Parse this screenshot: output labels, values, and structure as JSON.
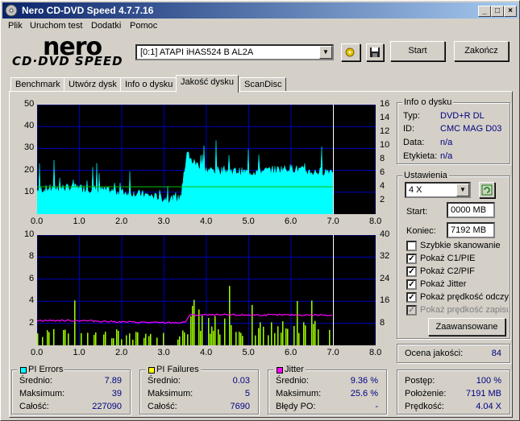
{
  "window": {
    "title": "Nero CD-DVD Speed 4.7.7.16"
  },
  "menu": [
    "Plik",
    "Uruchom test",
    "Dodatki",
    "Pomoc"
  ],
  "logo": {
    "top": "nero",
    "bottom": "CD·DVD SPEED"
  },
  "drive": {
    "selected": "[0:1]   ATAPI iHAS524   B AL2A"
  },
  "buttons": {
    "start": "Start",
    "end": "Zakończ",
    "advanced": "Zaawansowane"
  },
  "tabs": [
    "Benchmark",
    "Utwórz dysk",
    "Info o dysku",
    "Jakość dysku",
    "ScanDisc"
  ],
  "active_tab": "Jakość dysku",
  "disc_info": {
    "title": "Info o dysku",
    "rows": [
      {
        "label": "Typ:",
        "value": "DVD+R DL"
      },
      {
        "label": "ID:",
        "value": "CMC MAG D03"
      },
      {
        "label": "Data:",
        "value": "n/a"
      },
      {
        "label": "Etykieta:",
        "value": "n/a"
      }
    ]
  },
  "settings": {
    "title": "Ustawienia",
    "speed": "4 X",
    "start_label": "Start:",
    "start_value": "0000 MB",
    "end_label": "Koniec:",
    "end_value": "7192 MB",
    "checks": [
      {
        "label": "Szybkie skanowanie",
        "checked": false,
        "disabled": false
      },
      {
        "label": "Pokaż C1/PIE",
        "checked": true,
        "disabled": false
      },
      {
        "label": "Pokaż C2/PIF",
        "checked": true,
        "disabled": false
      },
      {
        "label": "Pokaż Jitter",
        "checked": true,
        "disabled": false
      },
      {
        "label": "Pokaż prędkość odczytu",
        "checked": true,
        "disabled": false
      },
      {
        "label": "Pokaż prędkość zapisu",
        "checked": true,
        "disabled": true
      }
    ]
  },
  "quality": {
    "label": "Ocena jakości:",
    "value": "84"
  },
  "progress": {
    "rows": [
      {
        "label": "Postęp:",
        "value": "100 %"
      },
      {
        "label": "Położenie:",
        "value": "7191 MB"
      },
      {
        "label": "Prędkość:",
        "value": "4.04 X"
      }
    ]
  },
  "pi_errors": {
    "title": "PI Errors",
    "color": "#00c0c0",
    "rows": [
      {
        "label": "Średnio:",
        "value": "7.89"
      },
      {
        "label": "Maksimum:",
        "value": "39"
      },
      {
        "label": "Całość:",
        "value": "227090"
      }
    ]
  },
  "pi_failures": {
    "title": "PI Failures",
    "color": "#e0e000",
    "rows": [
      {
        "label": "Średnio:",
        "value": "0.03"
      },
      {
        "label": "Maksimum:",
        "value": "5"
      },
      {
        "label": "Całość:",
        "value": "7690"
      }
    ]
  },
  "jitter": {
    "title": "Jitter",
    "color": "#e000e0",
    "rows": [
      {
        "label": "Średnio:",
        "value": "9.36 %"
      },
      {
        "label": "Maksimum:",
        "value": "25.6 %"
      },
      {
        "label": "Błędy PO:",
        "value": "-"
      }
    ]
  },
  "chart_data": [
    {
      "type": "area",
      "title": "",
      "xlabel": "",
      "ylabel": "",
      "x_ticks": [
        "0.0",
        "1.0",
        "2.0",
        "3.0",
        "4.0",
        "5.0",
        "6.0",
        "7.0",
        "8.0"
      ],
      "y_left_ticks": [
        "10",
        "20",
        "30",
        "40",
        "50"
      ],
      "y_right_ticks": [
        "2",
        "4",
        "6",
        "8",
        "10",
        "12",
        "14",
        "16"
      ],
      "xlim": [
        0,
        8
      ],
      "ylim": [
        0,
        50
      ],
      "y2lim": [
        0,
        16
      ],
      "series": [
        {
          "values_x": [
            0,
            0.5,
            1,
            1.5,
            2,
            2.5,
            3,
            3.4,
            3.55,
            3.6,
            4,
            4.5,
            5,
            5.5,
            6,
            6.5,
            7.0
          ],
          "values_y": [
            11,
            12,
            12,
            11,
            10,
            9,
            7,
            7,
            30,
            25,
            20,
            20,
            19,
            20,
            21,
            19,
            20
          ]
        },
        {
          "values_x": [
            0,
            7.0
          ],
          "values_y": [
            4,
            4
          ]
        }
      ],
      "end_marker_x": 7.0,
      "colors": {
        "pie": "#00ffff",
        "speed": "#00c000",
        "grid": "#0000c0"
      }
    },
    {
      "type": "bar",
      "title": "",
      "xlabel": "",
      "ylabel": "",
      "x_ticks": [
        "0.0",
        "1.0",
        "2.0",
        "3.0",
        "4.0",
        "5.0",
        "6.0",
        "7.0",
        "8.0"
      ],
      "y_left_ticks": [
        "2",
        "4",
        "6",
        "8",
        "10"
      ],
      "y_right_ticks": [
        "8",
        "16",
        "24",
        "32",
        "40"
      ],
      "xlim": [
        0,
        8
      ],
      "ylim": [
        0,
        10
      ],
      "y2lim": [
        0,
        40
      ],
      "series": [
        {
          "values_x": [
            0,
            1,
            2,
            3,
            3.5,
            3.6,
            4,
            5,
            6,
            7.0
          ],
          "values_y": [
            1,
            1,
            1,
            1,
            1,
            3,
            2,
            1.5,
            1.5,
            1.5
          ]
        },
        {
          "values_x": [
            0,
            1,
            2,
            3,
            3.5,
            3.6,
            4,
            5,
            6,
            7.0
          ],
          "values_y": [
            9,
            9,
            8.5,
            8.2,
            8.3,
            11,
            11,
            11,
            11,
            11
          ]
        }
      ],
      "end_marker_x": 7.0,
      "colors": {
        "pif": "#a0ff00",
        "jitter": "#ff00ff",
        "grid": "#0000c0"
      }
    }
  ]
}
